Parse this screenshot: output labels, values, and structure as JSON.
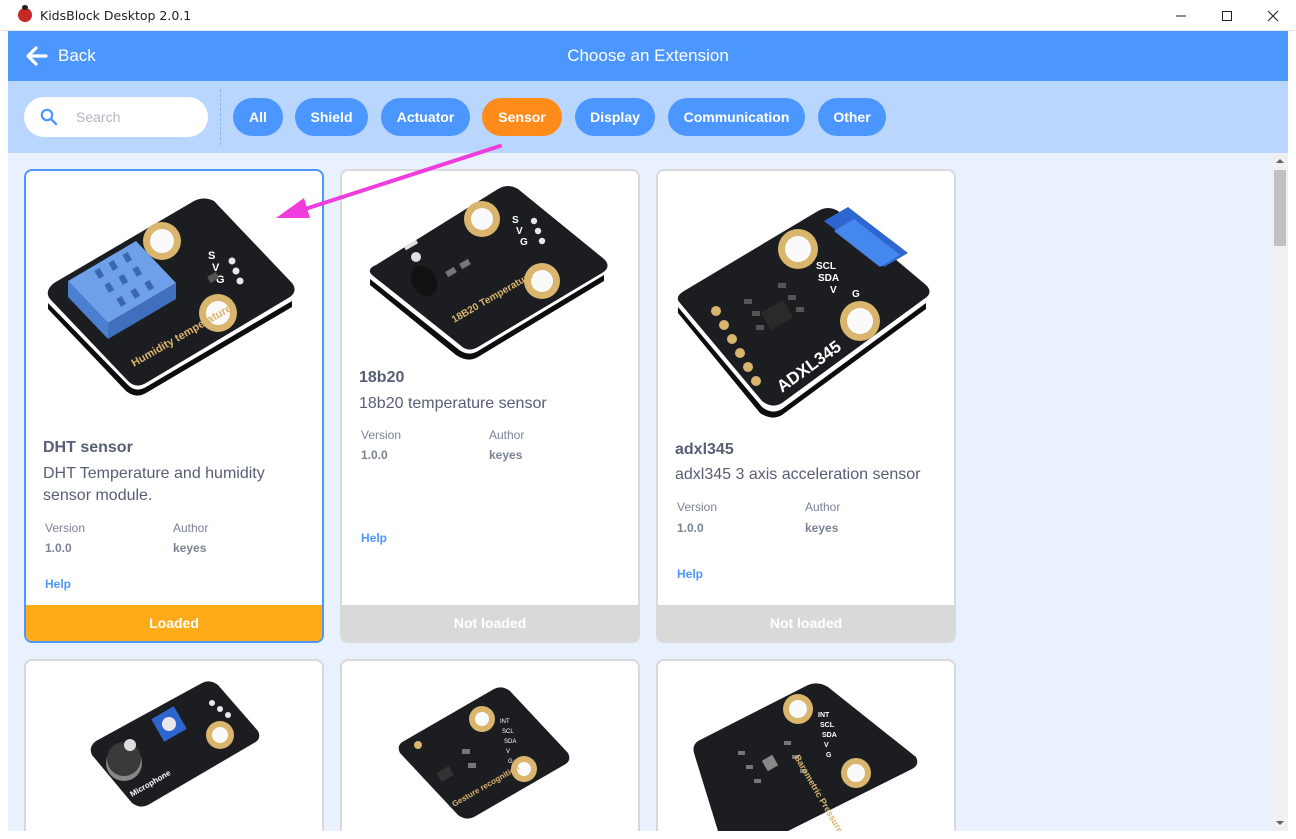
{
  "window": {
    "title": "KidsBlock Desktop 2.0.1",
    "controls": [
      "minimize-icon",
      "maximize-icon",
      "close-icon"
    ]
  },
  "header": {
    "back_label": "Back",
    "title": "Choose an Extension",
    "bg_color": "#4c97ff"
  },
  "search": {
    "placeholder": "Search",
    "value": ""
  },
  "filters": {
    "tags": [
      {
        "label": "All",
        "active": false
      },
      {
        "label": "Shield",
        "active": false
      },
      {
        "label": "Actuator",
        "active": false
      },
      {
        "label": "Sensor",
        "active": true
      },
      {
        "label": "Display",
        "active": false
      },
      {
        "label": "Communication",
        "active": false
      },
      {
        "label": "Other",
        "active": false
      }
    ],
    "active_color": "#ff8c1a",
    "inactive_color": "#4c97ff"
  },
  "labels": {
    "version": "Version",
    "author": "Author",
    "help": "Help"
  },
  "extensions": [
    {
      "name": "DHT sensor",
      "description": "DHT Temperature and humidity sensor module.",
      "version": "1.0.0",
      "author": "keyes",
      "status": "Loaded",
      "selected": true,
      "board_text": "Humidity temperature",
      "pins": [
        "S",
        "V",
        "G"
      ]
    },
    {
      "name": "18b20",
      "description": "18b20 temperature sensor",
      "version": "1.0.0",
      "author": "keyes",
      "status": "Not loaded",
      "selected": false,
      "board_text": "18B20 Temperature",
      "pins": [
        "S",
        "V",
        "G"
      ]
    },
    {
      "name": "adxl345",
      "description": "adxl345 3 axis acceleration sensor",
      "version": "1.0.0",
      "author": "keyes",
      "status": "Not loaded",
      "selected": false,
      "board_text": "ADXL345",
      "pins": [
        "SCL",
        "SDA",
        "V",
        "G"
      ]
    },
    {
      "board_text": "Microphone",
      "pins": []
    },
    {
      "board_text": "Gesture recognition",
      "pins": [
        "INT",
        "SCL",
        "SDA",
        "V",
        "G"
      ]
    },
    {
      "board_text": "Barometric Pressure",
      "pins": [
        "INT",
        "SCL",
        "SDA",
        "V",
        "G"
      ]
    }
  ]
}
